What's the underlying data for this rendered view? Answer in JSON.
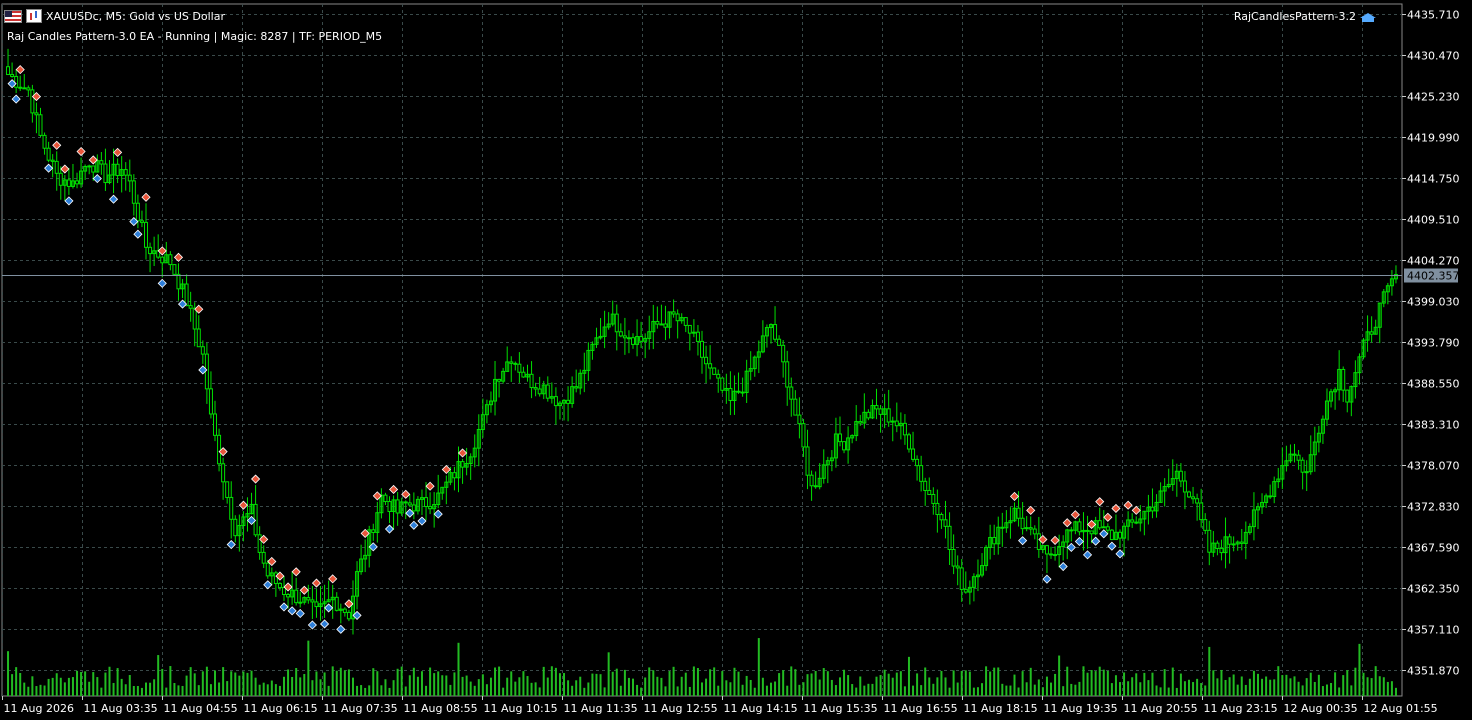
{
  "header": {
    "symbol_title": "XAUUSDc, M5:  Gold vs US Dollar",
    "ea_status": "Raj Candles Pattern-3.0 EA  -  Running | Magic: 8287 | TF: PERIOD_M5",
    "indicator_label": "RajCandlesPattern-3.2"
  },
  "icons": [
    "flag-icon",
    "bars-icon",
    "cap-icon"
  ],
  "colors": {
    "background": "#000000",
    "grid": "#3a4a4a",
    "candle": "#00e000",
    "volume": "#22bb22",
    "bid_line": "#8090a0",
    "bid_label_bg": "#8090a0",
    "bull_marker": "#2e7fd9",
    "bear_marker": "#e8553a",
    "axis_text": "#ffffff"
  },
  "chart_data": {
    "type": "candlestick",
    "symbol": "XAUUSDc",
    "timeframe": "M5",
    "ylim": [
      4348.5,
      4437.0
    ],
    "y_ticks": [
      "4435.710",
      "4430.470",
      "4425.230",
      "4419.990",
      "4414.750",
      "4409.510",
      "4404.270",
      "4399.030",
      "4393.790",
      "4388.550",
      "4383.310",
      "4378.070",
      "4372.830",
      "4367.590",
      "4362.350",
      "4357.110",
      "4351.870"
    ],
    "x_ticks": [
      "11 Aug 2026",
      "11 Aug 03:35",
      "11 Aug 04:55",
      "11 Aug 06:15",
      "11 Aug 07:35",
      "11 Aug 08:55",
      "11 Aug 10:15",
      "11 Aug 11:35",
      "11 Aug 12:55",
      "11 Aug 14:15",
      "11 Aug 15:35",
      "11 Aug 16:55",
      "11 Aug 18:15",
      "11 Aug 19:35",
      "11 Aug 20:55",
      "11 Aug 23:15",
      "12 Aug 00:35",
      "12 Aug 01:55"
    ],
    "current_price": "4402.357",
    "grid": true,
    "close_path": [
      [
        0,
        4428
      ],
      [
        5,
        4426
      ],
      [
        8,
        4420
      ],
      [
        12,
        4415
      ],
      [
        16,
        4414
      ],
      [
        20,
        4417
      ],
      [
        24,
        4415
      ],
      [
        28,
        4416
      ],
      [
        30,
        4414
      ],
      [
        34,
        4406
      ],
      [
        40,
        4404
      ],
      [
        44,
        4399
      ],
      [
        48,
        4392
      ],
      [
        50,
        4384
      ],
      [
        52,
        4379
      ],
      [
        54,
        4374
      ],
      [
        56,
        4370
      ],
      [
        60,
        4372
      ],
      [
        62,
        4367
      ],
      [
        64,
        4364
      ],
      [
        68,
        4362
      ],
      [
        72,
        4361
      ],
      [
        76,
        4359
      ],
      [
        80,
        4361
      ],
      [
        84,
        4359
      ],
      [
        86,
        4364
      ],
      [
        88,
        4367
      ],
      [
        92,
        4374
      ],
      [
        96,
        4372
      ],
      [
        98,
        4373
      ],
      [
        102,
        4373
      ],
      [
        106,
        4374
      ],
      [
        110,
        4377
      ],
      [
        114,
        4380
      ],
      [
        118,
        4385
      ],
      [
        120,
        4389
      ],
      [
        124,
        4392
      ],
      [
        128,
        4389
      ],
      [
        132,
        4388
      ],
      [
        136,
        4386
      ],
      [
        140,
        4388
      ],
      [
        144,
        4393
      ],
      [
        148,
        4397
      ],
      [
        152,
        4395
      ],
      [
        156,
        4394
      ],
      [
        160,
        4396
      ],
      [
        164,
        4397
      ],
      [
        168,
        4395
      ],
      [
        170,
        4393
      ],
      [
        174,
        4389
      ],
      [
        178,
        4386
      ],
      [
        182,
        4389
      ],
      [
        186,
        4394
      ],
      [
        188,
        4396
      ],
      [
        192,
        4389
      ],
      [
        196,
        4380
      ],
      [
        198,
        4375
      ],
      [
        200,
        4377
      ],
      [
        204,
        4381
      ],
      [
        206,
        4381
      ],
      [
        210,
        4384
      ],
      [
        214,
        4385
      ],
      [
        218,
        4384
      ],
      [
        222,
        4381
      ],
      [
        226,
        4375
      ],
      [
        230,
        4372
      ],
      [
        233,
        4365
      ],
      [
        236,
        4362
      ],
      [
        240,
        4366
      ],
      [
        244,
        4370
      ],
      [
        248,
        4372
      ],
      [
        252,
        4369
      ],
      [
        256,
        4366
      ],
      [
        260,
        4369
      ],
      [
        264,
        4370
      ],
      [
        268,
        4370
      ],
      [
        272,
        4369
      ],
      [
        276,
        4370
      ],
      [
        280,
        4372
      ],
      [
        284,
        4374
      ],
      [
        288,
        4377
      ],
      [
        292,
        4374
      ],
      [
        296,
        4367
      ],
      [
        300,
        4368
      ],
      [
        304,
        4369
      ],
      [
        308,
        4372
      ],
      [
        312,
        4376
      ],
      [
        316,
        4380
      ],
      [
        320,
        4377
      ],
      [
        324,
        4385
      ],
      [
        328,
        4390
      ],
      [
        330,
        4387
      ],
      [
        334,
        4393
      ],
      [
        338,
        4398
      ],
      [
        342,
        4402.4
      ]
    ],
    "bull_markers_idx": [
      1,
      2,
      10,
      15,
      22,
      26,
      31,
      32,
      38,
      43,
      48,
      55,
      60,
      64,
      68,
      70,
      72,
      75,
      78,
      79,
      82,
      86,
      90,
      94,
      99,
      100,
      102,
      106,
      250,
      256,
      260,
      262,
      264,
      266,
      268,
      270,
      272,
      274
    ],
    "bear_markers_idx": [
      3,
      7,
      12,
      14,
      18,
      21,
      27,
      34,
      38,
      42,
      47,
      53,
      58,
      61,
      63,
      65,
      67,
      69,
      71,
      73,
      76,
      80,
      84,
      88,
      91,
      95,
      98,
      104,
      108,
      112,
      248,
      252,
      255,
      258,
      261,
      263,
      267,
      269,
      271,
      273,
      276,
      278
    ],
    "volume_level": [
      0.12,
      0.65,
      0.32,
      0.28,
      0.18
    ]
  }
}
